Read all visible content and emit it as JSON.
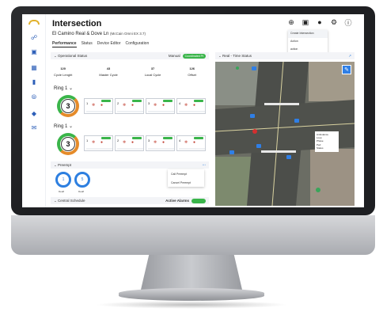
{
  "app": {
    "title": "Intersection",
    "subtitle": "El Camino Real & Dove Ln",
    "controller": "(McCain Omni EX 3.7)"
  },
  "tabs": [
    "Performance",
    "Status",
    "Device Editor",
    "Configuration"
  ],
  "top_icons": [
    "add-circle-icon",
    "save-icon",
    "user-icon",
    "gear-icon",
    "help-icon"
  ],
  "user_menu": [
    "Create Intersection",
    "Action",
    "action"
  ],
  "operational_status": {
    "label": "Operational Status",
    "mode": "Manual",
    "badge": "Coordinated Pt",
    "stats": [
      {
        "value": "120",
        "label": "Cycle Lenght"
      },
      {
        "value": "43",
        "label": "Master Cycle"
      },
      {
        "value": "37",
        "label": "Local Cycle"
      },
      {
        "value": "126",
        "label": "Offset"
      }
    ]
  },
  "rings": [
    {
      "label": "Ring 1",
      "phase": "3"
    },
    {
      "label": "Ring 1",
      "phase": "3"
    }
  ],
  "phases_ring1": [
    "1",
    "2",
    "3",
    "4"
  ],
  "phases_ring2": [
    "1",
    "2",
    "3",
    "4"
  ],
  "preempt": {
    "label": "Preempt",
    "buttons": [
      {
        "num": "1",
        "label": "Deafl"
      },
      {
        "num": "5",
        "label": "Deafl"
      }
    ],
    "menu": [
      "Call Preempt",
      "Cancel Preempt"
    ]
  },
  "central": {
    "label": "Central Schedule",
    "alarms": "Active Alarms"
  },
  "map": {
    "label": "Real - Time Status",
    "popup": [
      "Ambulance",
      "Loop",
      "Phase",
      "Ped",
      "Status"
    ]
  }
}
